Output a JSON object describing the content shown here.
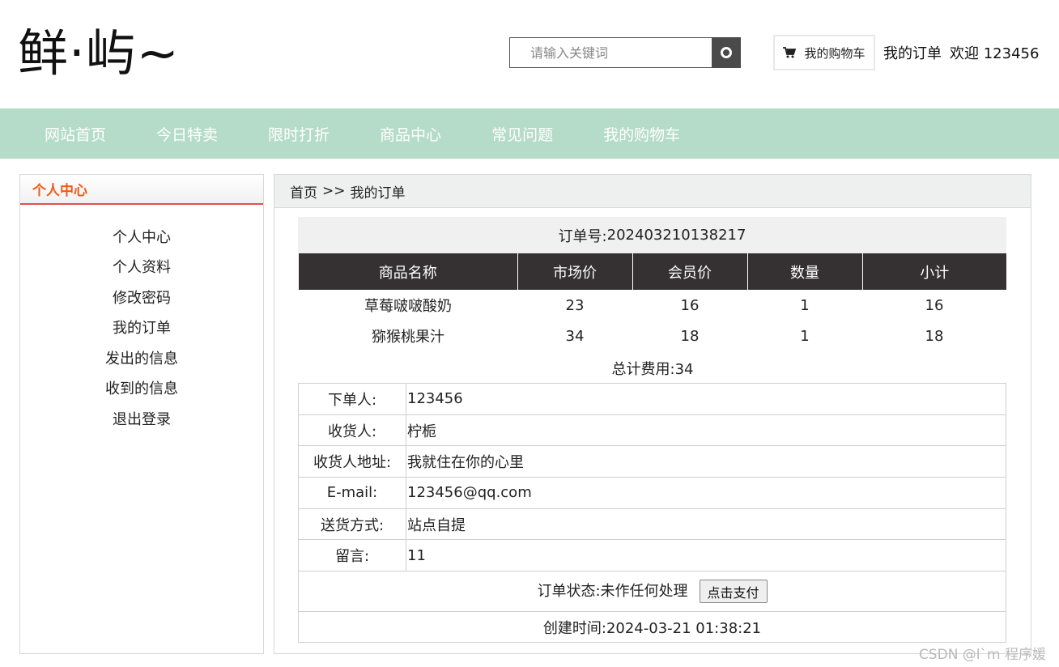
{
  "header": {
    "logo": "鲜·屿~",
    "search_placeholder": "请输入关键词",
    "cart_label": "我的购物车",
    "my_orders": "我的订单",
    "welcome": "欢迎 123456"
  },
  "nav": {
    "items": [
      "网站首页",
      "今日特卖",
      "限时打折",
      "商品中心",
      "常见问题",
      "我的购物车"
    ]
  },
  "sidebar": {
    "title": "个人中心",
    "items": [
      "个人中心",
      "个人资料",
      "修改密码",
      "我的订单",
      "发出的信息",
      "收到的信息",
      "退出登录"
    ]
  },
  "breadcrumb": {
    "home": "首页",
    "separator": ">>",
    "current": "我的订单"
  },
  "order": {
    "number_label": "订单号:",
    "number": "202403210138217",
    "columns": [
      "商品名称",
      "市场价",
      "会员价",
      "数量",
      "小计"
    ],
    "rows": [
      [
        "草莓啵啵酸奶",
        "23",
        "16",
        "1",
        "16"
      ],
      [
        "猕猴桃果汁",
        "34",
        "18",
        "1",
        "18"
      ]
    ],
    "total_text": "总计费用:34",
    "info": {
      "orderer_label": "下单人:",
      "orderer": "123456",
      "receiver_label": "收货人:",
      "receiver": "柠栀",
      "address_label": "收货人地址:",
      "address": "我就住在你的心里",
      "email_label": "E-mail:",
      "email": "123456@qq.com",
      "delivery_label": "送货方式:",
      "delivery": "站点自提",
      "message_label": "留言:",
      "message": "11"
    },
    "status_label": "订单状态:",
    "status": "未作任何处理",
    "pay_button": "点击支付",
    "created_label": "创建时间:",
    "created": "2024-03-21 01:38:21"
  },
  "watermark": "CSDN @l`m 程序媛",
  "colors": {
    "nav_bg": "#b5dcc8",
    "table_header_bg": "#353032",
    "sidebar_title": "#f05a14",
    "sidebar_underline": "#e05050"
  }
}
